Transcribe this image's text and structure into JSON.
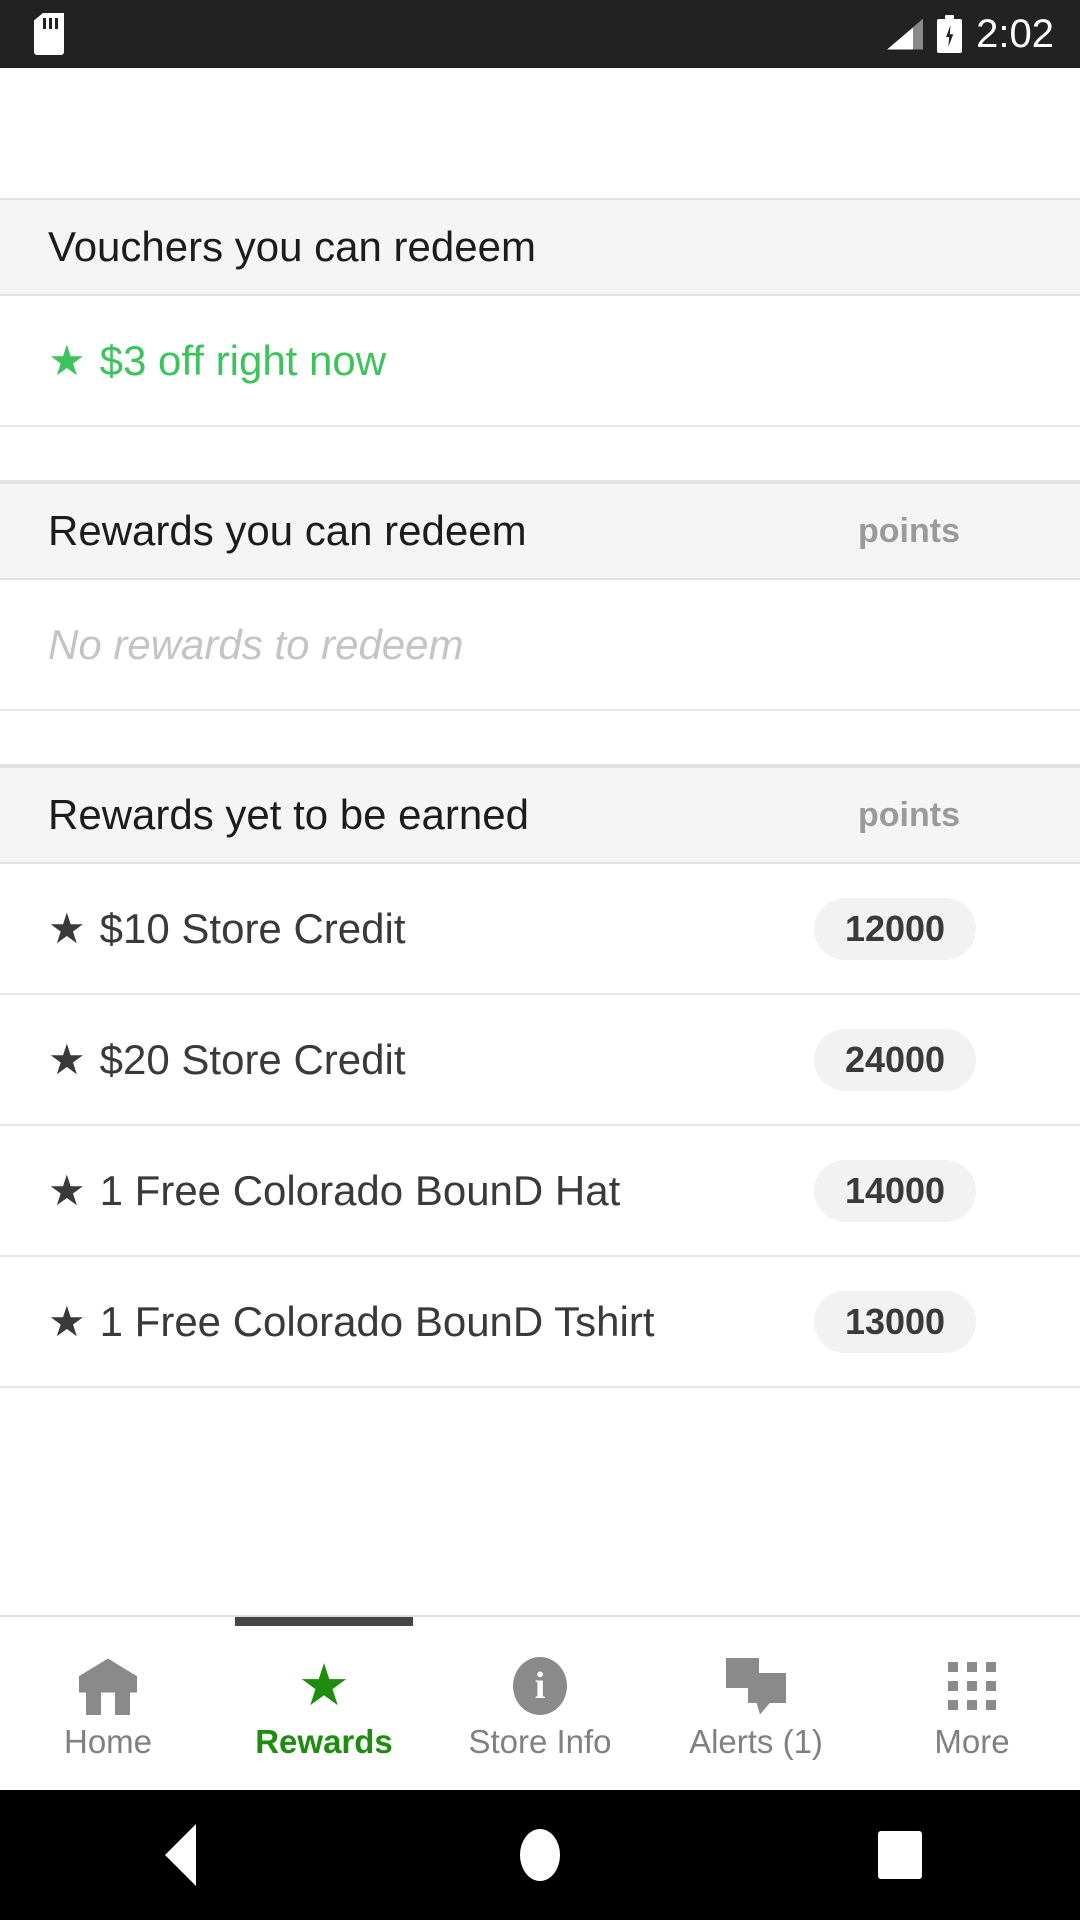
{
  "status_bar": {
    "sd_card_icon": "sd-card-icon",
    "wifi_icon": "wifi-icon",
    "signal_icon": "cellular-signal-icon",
    "battery_icon": "battery-charging-icon",
    "time": "2:02",
    "background_color": "#222222"
  },
  "sections": [
    {
      "id": "vouchers",
      "title": "Vouchers you can redeem",
      "unit": "",
      "rows": [
        {
          "star": "★",
          "label": "$3 off right now",
          "points": "",
          "green": true
        }
      ]
    },
    {
      "id": "rewards_redeem",
      "title": "Rewards you can redeem",
      "unit": "points",
      "empty_text": "No rewards to redeem",
      "rows": []
    },
    {
      "id": "rewards_earn",
      "title": "Rewards yet to be earned",
      "unit": "points",
      "rows": [
        {
          "star": "★",
          "label": "$10 Store Credit",
          "points": "12000",
          "green": false
        },
        {
          "star": "★",
          "label": "$20 Store Credit",
          "points": "24000",
          "green": false
        },
        {
          "star": "★",
          "label": "1 Free Colorado BounD Hat",
          "points": "14000",
          "green": false
        },
        {
          "star": "★",
          "label": "1 Free Colorado BounD Tshirt",
          "points": "13000",
          "green": false
        }
      ]
    }
  ],
  "tabbar": {
    "items": [
      {
        "id": "home",
        "label": "Home",
        "icon": "home-icon",
        "active": false
      },
      {
        "id": "rewards",
        "label": "Rewards",
        "icon": "star-icon",
        "active": true
      },
      {
        "id": "store_info",
        "label": "Store Info",
        "icon": "info-icon",
        "active": false
      },
      {
        "id": "alerts",
        "label": "Alerts (1)",
        "icon": "chat-icon",
        "active": false
      },
      {
        "id": "more",
        "label": "More",
        "icon": "grid-dots-icon",
        "active": false
      }
    ]
  },
  "navbar": {
    "back_icon": "back-triangle-icon",
    "home_icon": "home-circle-icon",
    "recents_icon": "recents-square-icon"
  },
  "colors": {
    "voucher_green": "#3cc35c",
    "active_tab_green": "#1e8c0e",
    "section_header_bg": "#f5f5f5",
    "pill_bg": "#f2f2f2",
    "muted_text": "#9a9a9a",
    "empty_text": "#c4c4c4"
  }
}
